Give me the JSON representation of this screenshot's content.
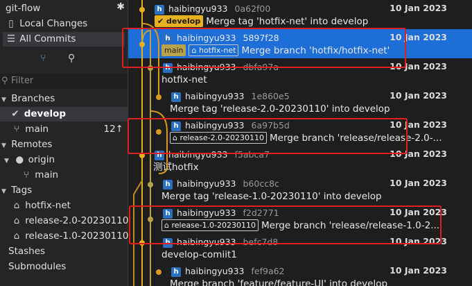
{
  "sidebar": {
    "repo_title": "git-flow",
    "nav": {
      "local_changes": "Local Changes",
      "all_commits": "All Commits"
    },
    "filter_placeholder": "Filter",
    "branches_header": "Branches",
    "branches": [
      {
        "name": "develop"
      },
      {
        "name": "main",
        "badge": "12↑"
      }
    ],
    "remotes_header": "Remotes",
    "remote": {
      "name": "origin",
      "branch": "main"
    },
    "tags_header": "Tags",
    "tags": [
      "hotfix-net",
      "release-2.0-20230110",
      "release-1.0-20230110"
    ],
    "stashes": "Stashes",
    "submodules": "Submodules"
  },
  "commits": [
    {
      "avatar": "h",
      "author": "haibingyu933",
      "hash": "0a62f00",
      "date": "10 Jan 2023",
      "refs": [
        "develop"
      ],
      "message": "Merge tag 'hotfix-net' into develop"
    },
    {
      "avatar": "h",
      "author": "haibingyu933",
      "hash": "5897f28",
      "date": "10 Jan 2023",
      "refs": [
        "main",
        "hotfix-net"
      ],
      "message": "Merge branch 'hotfix/hotfix-net'"
    },
    {
      "avatar": "h",
      "author": "haibingyu933",
      "hash": "dbfa97a",
      "date": "10 Jan 2023",
      "refs": [],
      "message": "hotfix-net"
    },
    {
      "avatar": "h",
      "author": "haibingyu933",
      "hash": "1e860e5",
      "date": "10 Jan 2023",
      "refs": [],
      "message": "Merge tag 'release-2.0-20230110' into develop"
    },
    {
      "avatar": "h",
      "author": "haibingyu933",
      "hash": "6a97b5d",
      "date": "10 Jan 2023",
      "refs": [
        "release-2.0-20230110"
      ],
      "message": "Merge branch 'release/release-2.0-..."
    },
    {
      "avatar": "h",
      "author": "haibingyu933",
      "hash": "f5abca7",
      "date": "10 Jan 2023",
      "refs": [],
      "message": "测试hotfix"
    },
    {
      "avatar": "h",
      "author": "haibingyu933",
      "hash": "b60cc8c",
      "date": "10 Jan 2023",
      "refs": [],
      "message": "Merge tag 'release-1.0-20230110' into develop"
    },
    {
      "avatar": "h",
      "author": "haibingyu933",
      "hash": "f2d2771",
      "date": "10 Jan 2023",
      "refs": [
        "release-1.0-20230110"
      ],
      "message": "Merge branch 'release/release-1.0-2..."
    },
    {
      "avatar": "h",
      "author": "haibingyu933",
      "hash": "befc7d8",
      "date": "10 Jan 2023",
      "refs": [],
      "message": "develop-comiit1"
    },
    {
      "avatar": "h",
      "author": "haibingyu933",
      "hash": "fef9a62",
      "date": "10 Jan 2023",
      "refs": [],
      "message": "Merge branch 'feature/feature-UI' into develop"
    }
  ],
  "selected_commit": "5897f28",
  "colors": {
    "accent": "#1d6ed6",
    "develop_lane": "#e6b020",
    "main_lane": "#b8a34a",
    "annotation": "#e02020"
  }
}
